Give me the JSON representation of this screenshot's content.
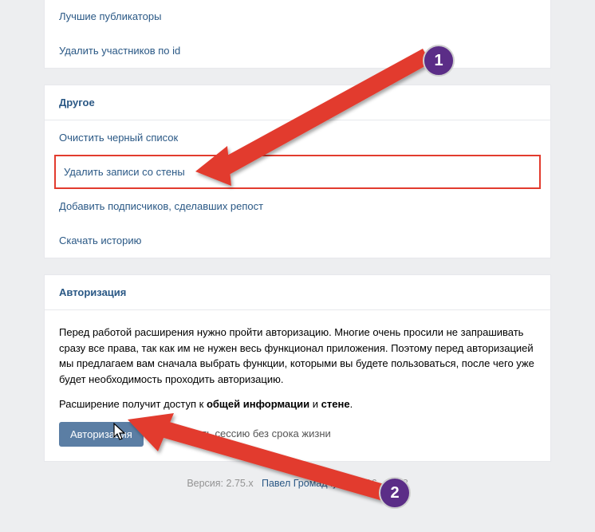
{
  "top_list": {
    "items": [
      {
        "label": "Лучшие публикаторы"
      },
      {
        "label": "Удалить участников по id"
      }
    ]
  },
  "other_section": {
    "title": "Другое",
    "items": [
      {
        "label": "Очистить черный список"
      },
      {
        "label": "Удалить записи со стены"
      },
      {
        "label": "Добавить подписчиков, сделавших репост"
      },
      {
        "label": "Скачать историю"
      }
    ]
  },
  "auth_section": {
    "title": "Авторизация",
    "intro": "Перед работой расширения нужно пройти авторизацию. Многие очень просили не запрашивать сразу все права, так как им не нужен весь функционал приложения. Поэтому перед авторизацией мы предлагаем вам сначала выбрать функции, которыми вы будете пользоваться, после чего уже будет необходимость проходить авторизацию.",
    "access_line_prefix": "Расширение получит доступ к ",
    "access_bold_1": "общей информации",
    "access_and": " и ",
    "access_bold_2": "стене",
    "access_suffix": ".",
    "button_label": "Авторизация",
    "checkbox_label": "- сделать сессию без срока жизни"
  },
  "footer": {
    "version_prefix": "Версия: ",
    "version": "2.75.x",
    "author": "Павел Громадчук",
    "copyright": " © 2016 - 2018"
  },
  "annotations": {
    "badge1": "1",
    "badge2": "2"
  }
}
